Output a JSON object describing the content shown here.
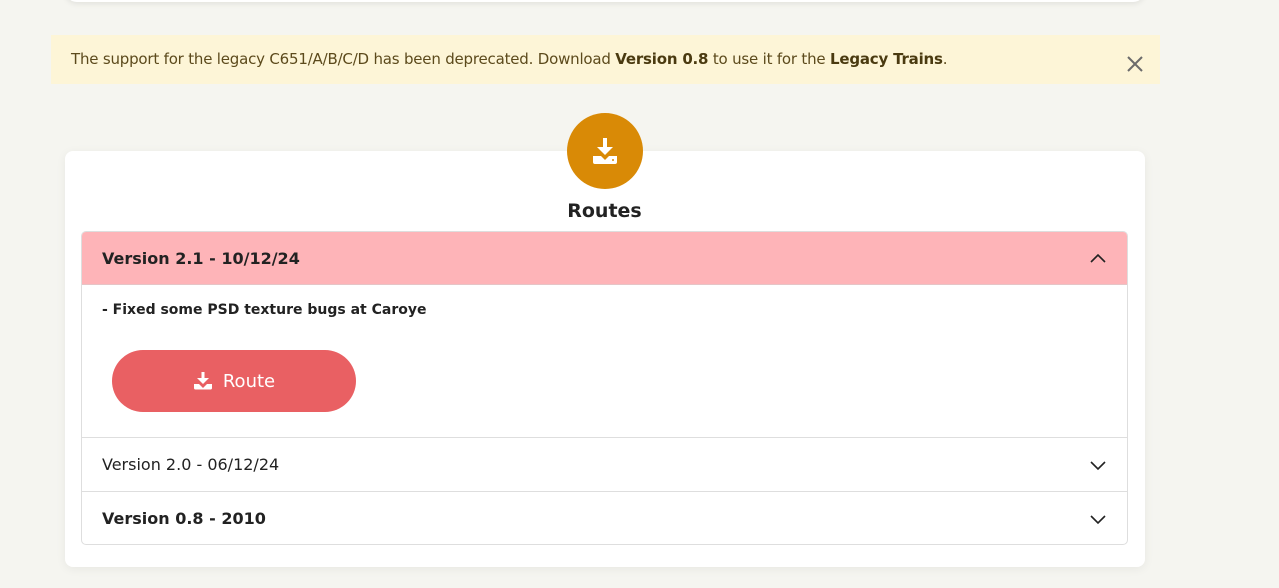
{
  "alert": {
    "text_prefix": "The support for the legacy C651/A/B/C/D has been deprecated. Download ",
    "version_link": "Version 0.8",
    "text_middle": " to use it for the ",
    "legacy_link": "Legacy Trains",
    "text_suffix": ".",
    "close_icon": "close-icon"
  },
  "section": {
    "icon": "download-icon",
    "title": "Routes",
    "accent_color": "#d98a06"
  },
  "accordion": {
    "open_item": {
      "title": "Version 2.1 - 10/12/24",
      "description": "- Fixed some PSD texture bugs at Caroye",
      "button_label": "Route",
      "button_icon": "download-icon",
      "header_color": "#feb4b8",
      "button_color": "#e96063"
    },
    "items": [
      {
        "title": "Version 2.0 - 06/12/24"
      },
      {
        "title": "Version 0.8 - 2010"
      }
    ]
  }
}
